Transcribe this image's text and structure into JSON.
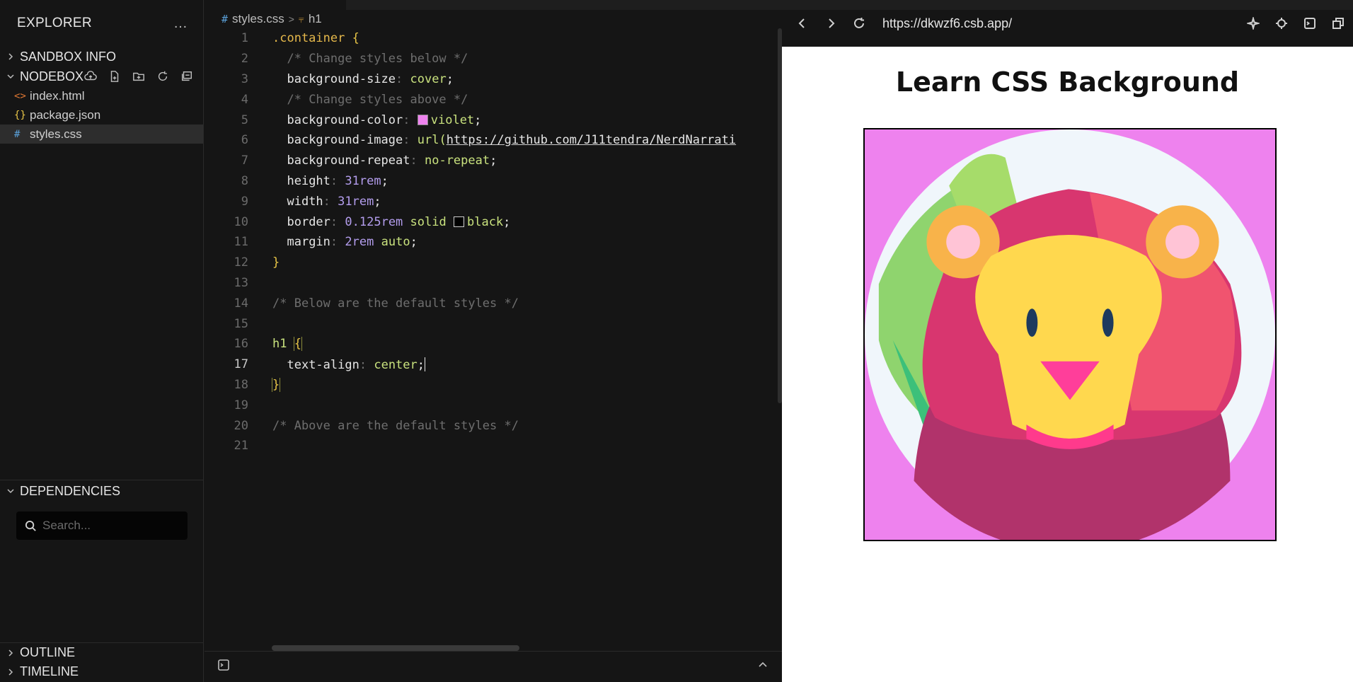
{
  "sidebar": {
    "title": "EXPLORER",
    "more": "…",
    "sandbox_info": "SANDBOX INFO",
    "nodebox": "NODEBOX",
    "files": [
      {
        "icon": "<>",
        "name": "index.html"
      },
      {
        "icon": "{}",
        "name": "package.json"
      },
      {
        "icon": "#",
        "name": "styles.css"
      }
    ],
    "dependencies": "DEPENDENCIES",
    "search_placeholder": "Search...",
    "outline": "OUTLINE",
    "timeline": "TIMELINE"
  },
  "editor": {
    "breadcrumb_file": "styles.css",
    "breadcrumb_symbol": "h1",
    "line_numbers": [
      "1",
      "2",
      "3",
      "4",
      "5",
      "6",
      "7",
      "8",
      "9",
      "10",
      "11",
      "12",
      "13",
      "14",
      "15",
      "16",
      "17",
      "18",
      "19",
      "20",
      "21"
    ],
    "lines": {
      "l1_sel": ".container",
      "l1_br": "{",
      "l2": "/* Change styles below */",
      "l3_prop": "background-size",
      "l3_val": "cover",
      "l4": "/* Change styles above */",
      "l5_prop": "background-color",
      "l5_val": "violet",
      "l6_prop": "background-image",
      "l6_fn": "url(",
      "l6_url": "https://github.com/J11tendra/NerdNarrati",
      "l7_prop": "background-repeat",
      "l7_val": "no-repeat",
      "l8_prop": "height",
      "l8_val": "31rem",
      "l9_prop": "width",
      "l9_val": "31rem",
      "l10_prop": "border",
      "l10_num": "0.125rem",
      "l10_solid": "solid",
      "l10_color": "black",
      "l11_prop": "margin",
      "l11_num": "2rem",
      "l11_auto": "auto",
      "l12": "}",
      "l14": "/* Below are the default styles */",
      "l16_sel": "h1",
      "l16_br": "{",
      "l17_prop": "text-align",
      "l17_val": "center",
      "l18": "}",
      "l20": "/* Above are the default styles */"
    },
    "colors": {
      "violet": "#ee82ee",
      "black": "#000000"
    }
  },
  "preview": {
    "url": "https://dkwzf6.csb.app/",
    "heading": "Learn CSS Background",
    "box_background": "violet"
  }
}
